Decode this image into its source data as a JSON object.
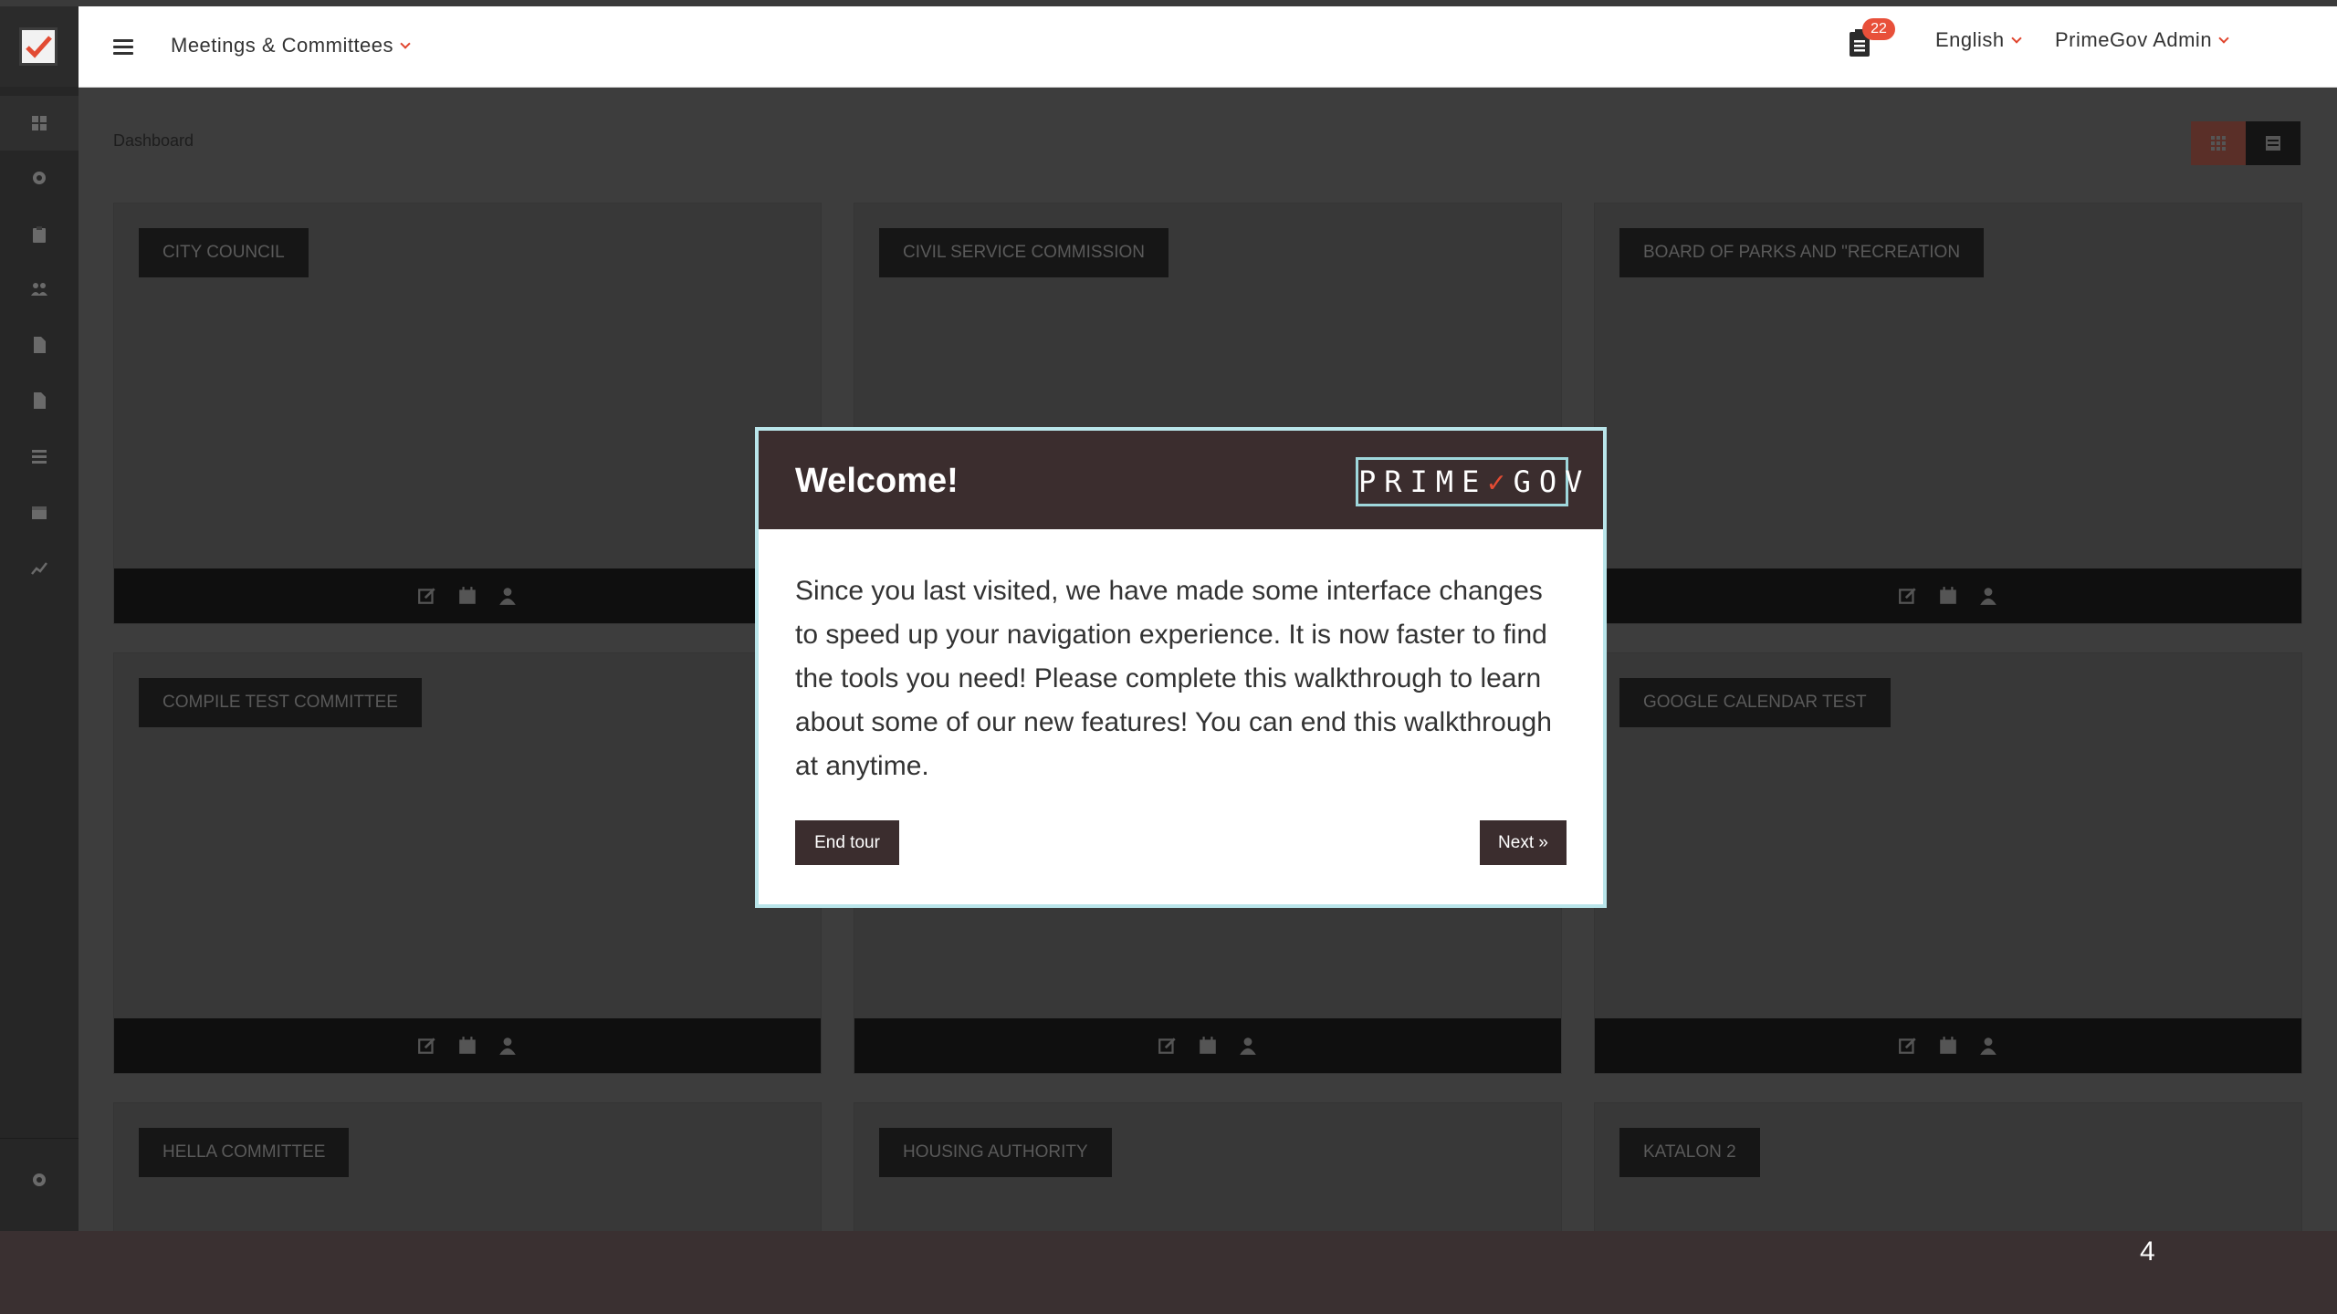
{
  "header": {
    "module_title": "Meetings & Committees",
    "notification_count": "22",
    "language": "English",
    "user": "PrimeGov Admin"
  },
  "sidebar": {
    "items": [
      {
        "icon": "dashboard-icon"
      },
      {
        "icon": "gear-icon"
      },
      {
        "icon": "clipboard-icon"
      },
      {
        "icon": "users-icon"
      },
      {
        "icon": "document-icon"
      },
      {
        "icon": "file-icon"
      },
      {
        "icon": "list-icon"
      },
      {
        "icon": "calendar-icon"
      },
      {
        "icon": "chart-icon"
      }
    ],
    "bottom_icon": "settings-icon"
  },
  "breadcrumb": "Dashboard",
  "cards": [
    {
      "label": "CITY COUNCIL"
    },
    {
      "label": "CIVIL SERVICE COMMISSION"
    },
    {
      "label": "BOARD OF PARKS AND \"RECREATION"
    },
    {
      "label": "COMPILE TEST COMMITTEE"
    },
    {
      "label": ""
    },
    {
      "label": "GOOGLE CALENDAR TEST"
    },
    {
      "label": "HELLA COMMITTEE"
    },
    {
      "label": "HOUSING AUTHORITY"
    },
    {
      "label": "KATALON 2"
    }
  ],
  "modal": {
    "title": "Welcome!",
    "brand": "PRIMEGOV",
    "body": "Since you last visited, we have made some interface changes to speed up your navigation experience. It is now faster to find the tools you need! Please complete this walkthrough to learn about some of our new features! You can end this walkthrough at anytime.",
    "end_label": "End tour",
    "next_label": "Next »"
  },
  "page_number": "4",
  "colors": {
    "accent": "#e24b33",
    "modal_header": "#3b2d2e",
    "modal_border": "#b9e5ea"
  }
}
